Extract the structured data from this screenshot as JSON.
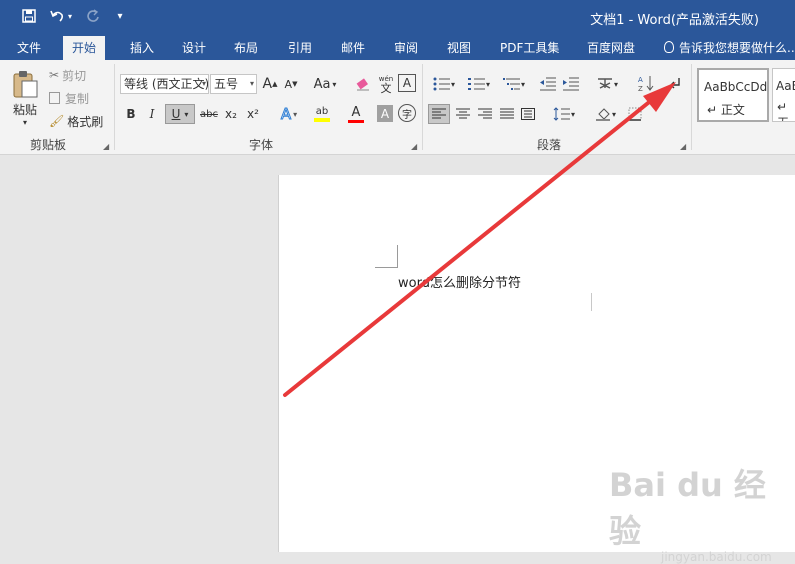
{
  "window": {
    "title": "文档1 - Word(产品激活失败)"
  },
  "tabs": [
    "文件",
    "开始",
    "插入",
    "设计",
    "布局",
    "引用",
    "邮件",
    "审阅",
    "视图",
    "PDF工具集",
    "百度网盘"
  ],
  "tell_me": "告诉我您想要做什么...",
  "clipboard": {
    "paste": "粘贴",
    "cut": "剪切",
    "copy": "复制",
    "format_painter": "格式刷",
    "label": "剪贴板"
  },
  "font": {
    "name": "等线 (西文正文)",
    "size": "五号",
    "case_btn": "Aa",
    "label": "字体",
    "bold": "B",
    "italic": "I",
    "underline": "U",
    "strike": "abc",
    "sub": "x₂",
    "sup": "x²",
    "pinyin_top": "wén",
    "pinyin_bottom": "文",
    "border_char": "A",
    "shade_char": "A",
    "effects_char": "A",
    "highlight_char": "ab",
    "color_char": "A",
    "circle_char": "字",
    "grow": "A",
    "shrink": "A"
  },
  "paragraph": {
    "label": "段落"
  },
  "styles": {
    "items": [
      {
        "preview": "AaBbCcDd",
        "name": "正文"
      },
      {
        "preview": "AaB",
        "name": "无"
      }
    ]
  },
  "document": {
    "text": "word怎么删除分节符"
  },
  "watermark": {
    "brand_line": "Bai du 经验",
    "url": "jingyan.baidu.com"
  },
  "colors": {
    "title_bar": "#2b579a",
    "ribbon": "#f3f3f3",
    "arrow": "#e8393a",
    "highlight": "#ffff00",
    "font_color": "#ff0000"
  }
}
